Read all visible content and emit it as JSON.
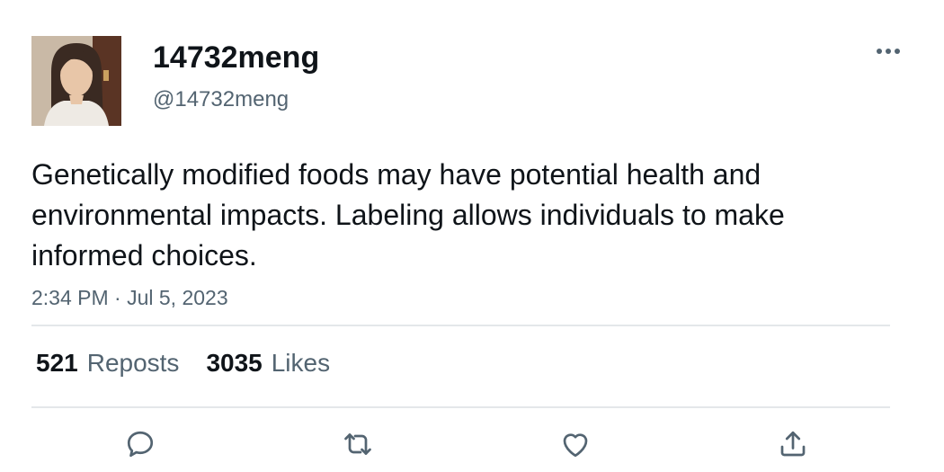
{
  "user": {
    "display_name": "14732meng",
    "handle": "@14732meng",
    "avatar_icon": "profile-photo"
  },
  "tweet": {
    "text": "Genetically modified foods may have potential health and environmental impacts. Labeling allows individuals to make informed choices.",
    "timestamp": "2:34 PM · Jul 5, 2023"
  },
  "stats": {
    "reposts_count": "521",
    "reposts_label": "Reposts",
    "likes_count": "3035",
    "likes_label": "Likes"
  },
  "actions": {
    "reply_icon": "reply-icon",
    "repost_icon": "repost-icon",
    "like_icon": "heart-icon",
    "share_icon": "share-icon"
  },
  "colors": {
    "text": "#0f1419",
    "secondary": "#536471",
    "divider": "#e4e7ea"
  }
}
